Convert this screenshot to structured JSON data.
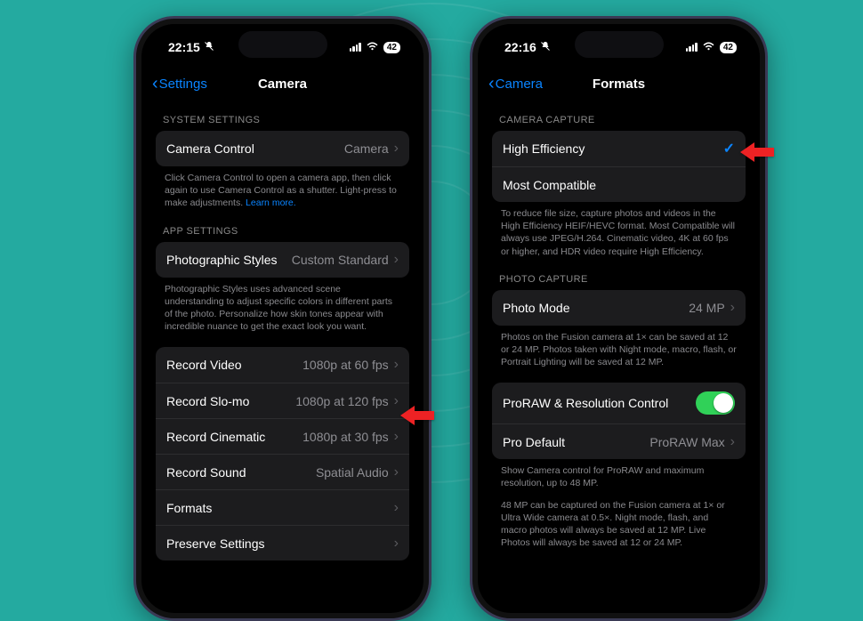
{
  "phone_left": {
    "status": {
      "time": "22:15",
      "battery": "42"
    },
    "nav": {
      "back": "Settings",
      "title": "Camera"
    },
    "section_system_header": "SYSTEM SETTINGS",
    "camera_control": {
      "label": "Camera Control",
      "value": "Camera"
    },
    "camera_control_footer_text": "Click Camera Control to open a camera app, then click again to use Camera Control as a shutter. Light-press to make adjustments. ",
    "camera_control_footer_link": "Learn more.",
    "section_app_header": "APP SETTINGS",
    "photographic_styles": {
      "label": "Photographic Styles",
      "value": "Custom Standard"
    },
    "photographic_styles_footer": "Photographic Styles uses advanced scene understanding to adjust specific colors in different parts of the photo. Personalize how skin tones appear with incredible nuance to get the exact look you want.",
    "rows": {
      "record_video": {
        "label": "Record Video",
        "value": "1080p at 60 fps"
      },
      "record_slomo": {
        "label": "Record Slo-mo",
        "value": "1080p at 120 fps"
      },
      "record_cinematic": {
        "label": "Record Cinematic",
        "value": "1080p at 30 fps"
      },
      "record_sound": {
        "label": "Record Sound",
        "value": "Spatial Audio"
      },
      "formats": {
        "label": "Formats"
      },
      "preserve": {
        "label": "Preserve Settings"
      }
    }
  },
  "phone_right": {
    "status": {
      "time": "22:16",
      "battery": "42"
    },
    "nav": {
      "back": "Camera",
      "title": "Formats"
    },
    "section_capture_header": "CAMERA CAPTURE",
    "capture": {
      "high_efficiency": "High Efficiency",
      "most_compatible": "Most Compatible"
    },
    "capture_footer": "To reduce file size, capture photos and videos in the High Efficiency HEIF/HEVC format. Most Compatible will always use JPEG/H.264. Cinematic video, 4K at 60 fps or higher, and HDR video require High Efficiency.",
    "section_photo_header": "PHOTO CAPTURE",
    "photo_mode": {
      "label": "Photo Mode",
      "value": "24 MP"
    },
    "photo_footer": "Photos on the Fusion camera at 1× can be saved at 12 or 24 MP. Photos taken with Night mode, macro, flash, or Portrait Lighting will be saved at 12 MP.",
    "proraw": {
      "label": "ProRAW & Resolution Control"
    },
    "pro_default": {
      "label": "Pro Default",
      "value": "ProRAW Max"
    },
    "proraw_footer1": "Show Camera control for ProRAW and maximum resolution, up to 48 MP.",
    "proraw_footer2": "48 MP can be captured on the Fusion camera at 1× or Ultra Wide camera at 0.5×. Night mode, flash, and macro photos will always be saved at 12 MP. Live Photos will always be saved at 12 or 24 MP."
  }
}
